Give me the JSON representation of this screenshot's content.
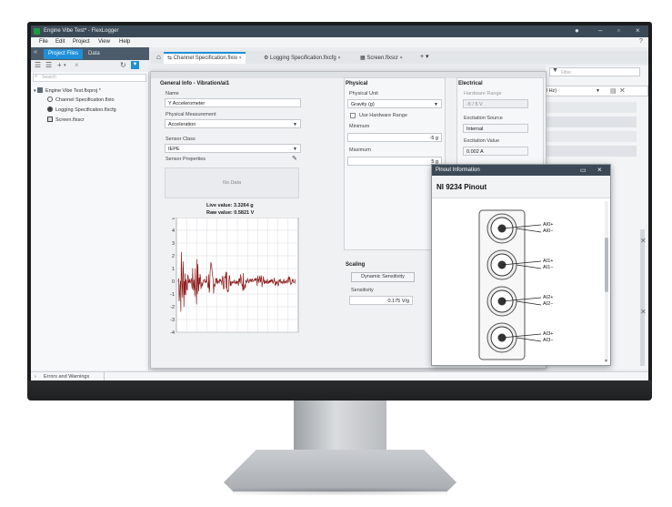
{
  "window": {
    "title": "Engine Vibe Test* - FlexLogger"
  },
  "menu": [
    "File",
    "Edit",
    "Project",
    "View",
    "Help"
  ],
  "project_panel": {
    "tabs": [
      "Project Files",
      "Data"
    ],
    "search_placeholder": "Search",
    "tree": [
      {
        "label": "Engine Vibe Test.flxproj *"
      },
      {
        "label": "Channel Specification.flxio"
      },
      {
        "label": "Logging Specification.flxcfg"
      },
      {
        "label": "Screen.flxscr"
      }
    ]
  },
  "document_tabs": [
    {
      "label": "Channel Specification.flxio",
      "active": true
    },
    {
      "label": "Logging Specification.flxcfg",
      "active": false
    },
    {
      "label": "Screen.flxscr",
      "active": false
    }
  ],
  "filter_placeholder": "Filter",
  "right_dropdown": "0 Hz)",
  "general": {
    "title": "General Info - Vibration/ai1",
    "name_label": "Name",
    "name_value": "Y Accelerometer",
    "physical_measurement_label": "Physical Measurement",
    "physical_measurement_value": "Acceleration",
    "sensor_class_label": "Sensor Class",
    "sensor_class_value": "IEPE",
    "sensor_properties_label": "Sensor Properties",
    "no_data": "No Data",
    "live_value": "Live value: 3.3264 g",
    "raw_value": "Raw value: 0.5821 V"
  },
  "physical": {
    "title": "Physical",
    "unit_label": "Physical Unit",
    "unit_value": "Gravity (g)",
    "use_hw_range_label": "Use Hardware Range",
    "min_label": "Minimum",
    "min_value": "-5 g",
    "max_label": "Maximum",
    "max_value": "5 g"
  },
  "electrical": {
    "title": "Electrical",
    "hw_range_label": "Hardware Range",
    "hw_range_value": "-5 / 5 V",
    "excitation_source_label": "Excitation Source",
    "excitation_source_value": "Internal",
    "excitation_value_label": "Excitation Value",
    "excitation_value": "0.002 A"
  },
  "scaling": {
    "title": "Scaling",
    "button_label": "Dynamic Sensitivity",
    "sensitivity_label": "Sensitivity",
    "sensitivity_value": "0.175 V/g"
  },
  "pinout": {
    "window_title": "Pinout Information",
    "module_name": "NI 9234 Pinout",
    "pins": [
      {
        "plus": "AI0+",
        "minus": "AI0−"
      },
      {
        "plus": "AI1+",
        "minus": "AI1−"
      },
      {
        "plus": "AI2+",
        "minus": "AI2−"
      },
      {
        "plus": "AI3+",
        "minus": "AI3−"
      }
    ]
  },
  "statusbar": {
    "errors_label": "Errors and Warnings"
  },
  "chart_data": {
    "type": "line",
    "ylim": [
      -4,
      5
    ],
    "yticks": [
      "5",
      "4",
      "3",
      "2",
      "1",
      "0",
      "-1",
      "-2",
      "-3",
      "-4"
    ],
    "baseline": 0,
    "line_color": "#8b1a1a",
    "grid": true
  }
}
